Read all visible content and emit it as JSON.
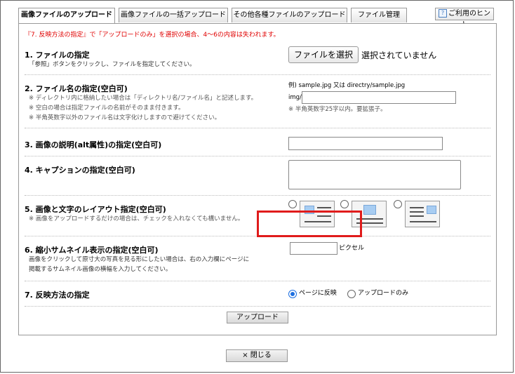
{
  "tabs": [
    {
      "label": "画像ファイルのアップロード",
      "active": true
    },
    {
      "label": "画像ファイルの一括アップロード",
      "active": false
    },
    {
      "label": "その他各種ファイルのアップロード",
      "active": false
    },
    {
      "label": "ファイル管理",
      "active": false
    }
  ],
  "hint": {
    "label": "ご利用のヒント",
    "icon": "?"
  },
  "notice": "『7. 反映方法の指定』で「アップロードのみ」を選択の場合、4〜6の内容は失われます。",
  "section1": {
    "title": "1. ファイルの指定",
    "desc": "「参照」ボタンをクリックし、ファイルを指定してください。",
    "file_button": "ファイルを選択",
    "file_status": "選択されていません"
  },
  "section2": {
    "title": "2. ファイル名の指定(空白可)",
    "notes": [
      "※ ディレクトリ内に格納したい場合は「ディレクトリ名/ファイル名」と記述します。",
      "※ 空白の場合は指定ファイルの名前がそのまま付きます。",
      "※ 半角英数字以外のファイル名は文字化けしますので避けてください。"
    ],
    "example": "例) sample.jpg 又は directry/sample.jpg",
    "prefix": "img/",
    "value": "",
    "hint": "※ 半角英数字25字以内。要拡張子。"
  },
  "section3": {
    "title": "3. 画像の説明(alt属性)の指定(空白可)",
    "value": ""
  },
  "section4": {
    "title": "4. キャプションの指定(空白可)",
    "value": ""
  },
  "section5": {
    "title": "5. 画像と文字のレイアウト指定(空白可)",
    "note": "※ 画像をアップロードするだけの場合は、チェックを入れなくても構いません。",
    "options": [
      "layout-image-left",
      "layout-image-top",
      "layout-image-right"
    ]
  },
  "section6": {
    "title": "6. 縮小サムネイル表示の指定(空白可)",
    "desc_line1": "画像をクリックして原寸大の写真を見る形にしたい場合は、右の入力欄にページに",
    "desc_line2": "掲載するサムネイル画像の横幅を入力してください。",
    "unit": "ピクセル",
    "value": ""
  },
  "section7": {
    "title": "7. 反映方法の指定",
    "option1": "ページに反映",
    "option2": "アップロードのみ",
    "selected": "option1"
  },
  "upload_button": "アップロード",
  "close_button": "× 閉じる",
  "colors": {
    "notice": "#e00000",
    "highlight": "#e01b1b",
    "radio_checked": "#1d6fe0"
  }
}
